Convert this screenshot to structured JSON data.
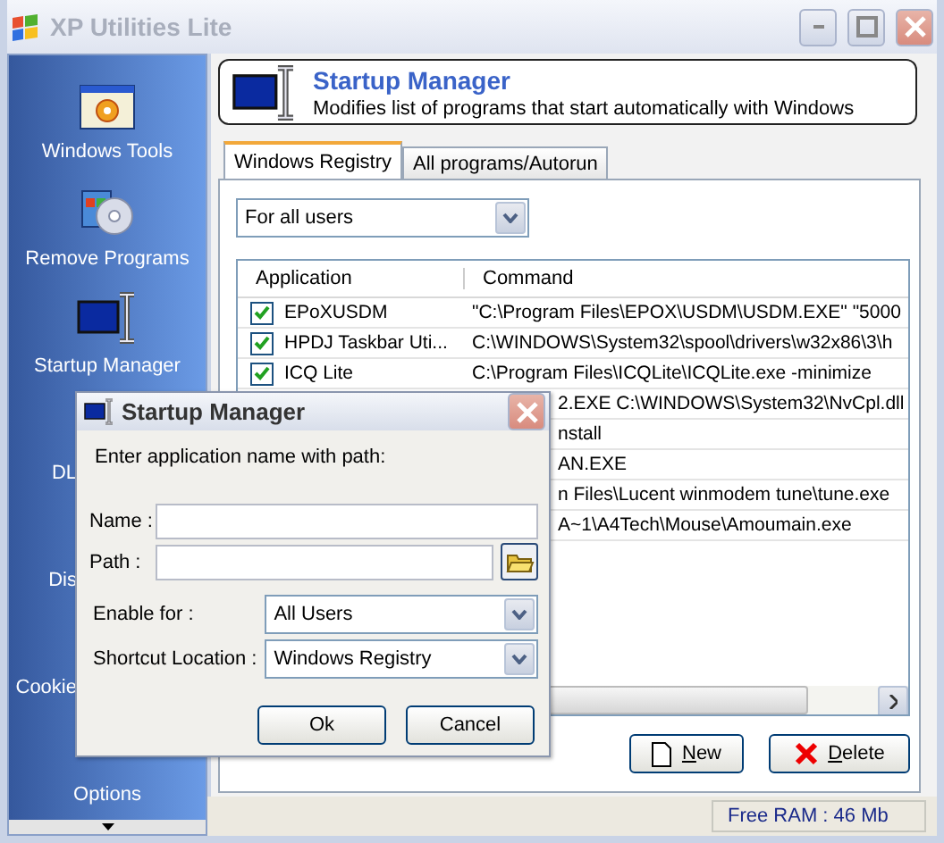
{
  "window": {
    "title": "XP Utilities Lite"
  },
  "sidebar": {
    "items": [
      {
        "label": "Windows Tools",
        "kind": "full"
      },
      {
        "label": "Remove Programs",
        "kind": "full"
      },
      {
        "label": "Startup Manager",
        "kind": "full"
      },
      {
        "label": "DL",
        "kind": "partial"
      },
      {
        "label": "Dis",
        "kind": "partial"
      },
      {
        "label": "Cookie",
        "kind": "partial"
      },
      {
        "label": "Options",
        "kind": "label"
      }
    ]
  },
  "header": {
    "title": "Startup Manager",
    "subtitle": "Modifies list of programs that start automatically with Windows"
  },
  "tabs": [
    {
      "label": "Windows Registry",
      "selected": true
    },
    {
      "label": "All programs/Autorun",
      "selected": false
    }
  ],
  "filter": {
    "value": "For all users"
  },
  "table": {
    "columns": [
      "Application",
      "Command"
    ],
    "rows": [
      {
        "kind": "full",
        "checked": true,
        "application": "EPoXUSDM",
        "command": "\"C:\\Program Files\\EPOX\\USDM\\USDM.EXE\" \"5000"
      },
      {
        "kind": "full",
        "checked": true,
        "application": "HPDJ Taskbar Uti...",
        "command": "C:\\WINDOWS\\System32\\spool\\drivers\\w32x86\\3\\h"
      },
      {
        "kind": "full",
        "checked": true,
        "application": "ICQ Lite",
        "command": "C:\\Program Files\\ICQLite\\ICQLite.exe -minimize"
      },
      {
        "kind": "partial",
        "command": "2.EXE C:\\WINDOWS\\System32\\NvCpl.dll"
      },
      {
        "kind": "partial",
        "command": "nstall"
      },
      {
        "kind": "partial",
        "command": "AN.EXE"
      },
      {
        "kind": "partial",
        "command": "n Files\\Lucent winmodem tune\\tune.exe"
      },
      {
        "kind": "partial",
        "command": "A~1\\A4Tech\\Mouse\\Amoumain.exe"
      }
    ]
  },
  "buttons": [
    "New",
    "Delete"
  ],
  "status_bar": {
    "free_ram": "Free RAM : 46 Mb"
  },
  "dialog": {
    "title": "Startup Manager",
    "prompt": "Enter application name with path:",
    "name_label": "Name :",
    "path_label": "Path :",
    "selects": [
      {
        "label": "Enable for :",
        "value": "All Users"
      },
      {
        "label": "Shortcut Location :",
        "value": "Windows Registry"
      }
    ],
    "buttons": [
      "Ok",
      "Cancel"
    ]
  }
}
